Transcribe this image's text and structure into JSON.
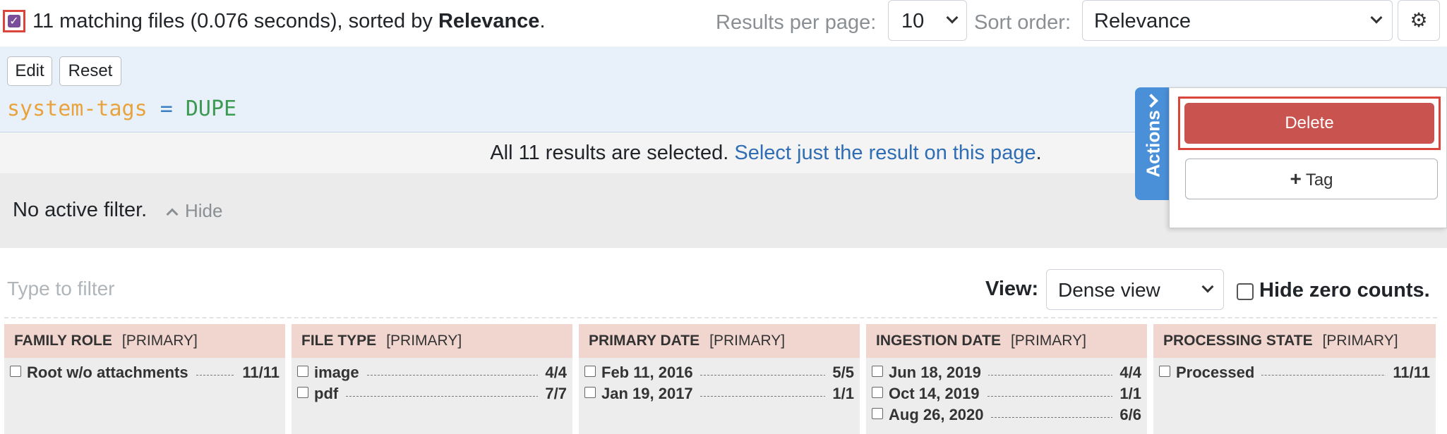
{
  "header": {
    "select_all_checked": true,
    "summary_prefix": "11 matching files (0.076 seconds), sorted by ",
    "summary_sort": "Relevance",
    "summary_suffix": ".",
    "results_per_page_label": "Results per page:",
    "results_per_page_value": "10",
    "sort_order_label": "Sort order:",
    "sort_order_value": "Relevance",
    "settings_icon": "gear-icon"
  },
  "query": {
    "edit_label": "Edit",
    "reset_label": "Reset",
    "key": "system-tags",
    "operator": "=",
    "value": "DUPE"
  },
  "selection": {
    "notice": "All 11 results are selected.",
    "link": "Select just the result on this page",
    "suffix": "."
  },
  "filter_status": {
    "text": "No active filter.",
    "hide_label": "Hide"
  },
  "filter_bar": {
    "type_placeholder": "Type to filter",
    "view_label": "View:",
    "view_value": "Dense view",
    "hide_zero_label": "Hide zero counts.",
    "hide_zero_checked": false
  },
  "facets": [
    {
      "name": "FAMILY ROLE",
      "tag": "[PRIMARY]",
      "items": [
        {
          "label": "Root w/o attachments",
          "count": "11/11"
        }
      ]
    },
    {
      "name": "FILE TYPE",
      "tag": "[PRIMARY]",
      "items": [
        {
          "label": "image",
          "count": "4/4"
        },
        {
          "label": "pdf",
          "count": "7/7"
        }
      ]
    },
    {
      "name": "PRIMARY DATE",
      "tag": "[PRIMARY]",
      "items": [
        {
          "label": "Feb 11, 2016",
          "count": "5/5"
        },
        {
          "label": "Jan 19, 2017",
          "count": "1/1"
        }
      ]
    },
    {
      "name": "INGESTION DATE",
      "tag": "[PRIMARY]",
      "items": [
        {
          "label": "Jun 18, 2019",
          "count": "4/4"
        },
        {
          "label": "Oct 14, 2019",
          "count": "1/1"
        },
        {
          "label": "Aug 26, 2020",
          "count": "6/6"
        }
      ]
    },
    {
      "name": "PROCESSING STATE",
      "tag": "[PRIMARY]",
      "items": [
        {
          "label": "Processed",
          "count": "11/11"
        }
      ]
    }
  ],
  "actions": {
    "tab_label": "Actions",
    "delete_label": "Delete",
    "tag_label": "Tag"
  },
  "colors": {
    "accent": "#4a90d9",
    "danger": "#c9534f",
    "highlight": "#d9453b",
    "facet_header": "#f1d6d0",
    "link": "#2f6db4"
  }
}
